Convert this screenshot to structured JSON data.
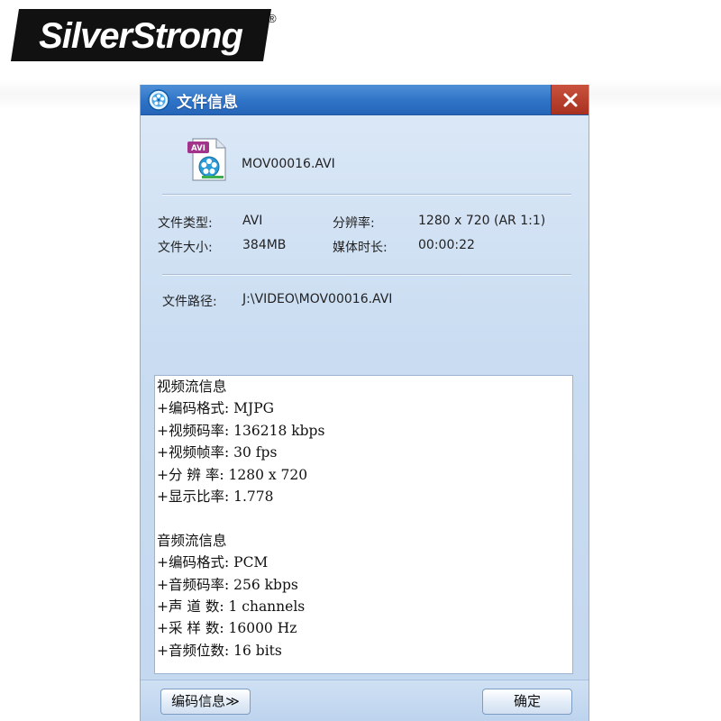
{
  "brand": {
    "logo_text": "SilverStrong",
    "registered_mark": "®"
  },
  "dialog": {
    "title": "文件信息",
    "file_name": "MOV00016.AVI",
    "file_icon_badge": "AVI",
    "fields": {
      "type_label": "文件类型:",
      "type_value": "AVI",
      "size_label": "文件大小:",
      "size_value": "384MB",
      "resolution_label": "分辨率:",
      "resolution_value": "1280 x 720 (AR 1:1)",
      "duration_label": "媒体时长:",
      "duration_value": "00:00:22",
      "path_label": "文件路径:",
      "path_value": "J:\\VIDEO\\MOV00016.AVI"
    },
    "video_info": {
      "heading": "视频流信息",
      "lines": [
        "+编码格式: MJPG",
        "+视频码率: 136218 kbps",
        "+视频帧率: 30 fps",
        "+分 辨 率: 1280 x 720",
        "+显示比率: 1.778"
      ]
    },
    "audio_info": {
      "heading": "音频流信息",
      "lines": [
        "+编码格式: PCM",
        "+音频码率: 256 kbps",
        "+声 道 数: 1 channels",
        "+采 样 数: 16000 Hz",
        "+音频位数: 16 bits"
      ]
    },
    "buttons": {
      "codec_label": "编码信息≫",
      "ok_label": "确定"
    },
    "icons": {
      "app": "film-reel-icon",
      "close": "close-icon",
      "file": "avi-video-file-icon"
    }
  },
  "colors": {
    "titlebar": "#2f73c7",
    "close_button": "#b83c28",
    "dialog_body": "#c9dcf1",
    "logo_box": "#111111"
  }
}
